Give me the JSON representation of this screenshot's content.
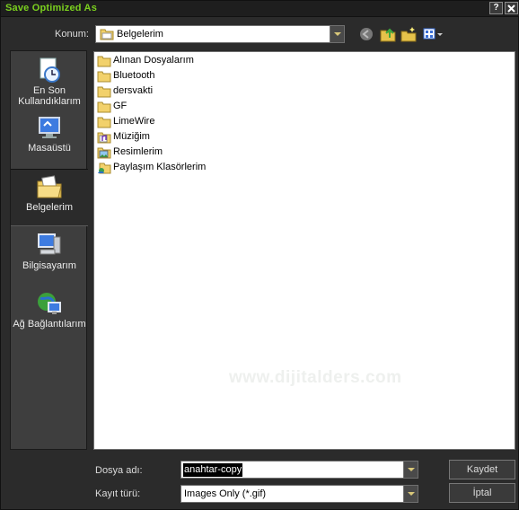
{
  "window": {
    "title": "Save Optimized As",
    "help_glyph": "?",
    "close_glyph": "X"
  },
  "location": {
    "label": "Konum:",
    "value": "Belgelerim"
  },
  "nav": {
    "back_icon": "back-arrow-icon",
    "up_icon": "up-folder-icon",
    "new_folder_icon": "new-folder-icon",
    "views_icon": "views-menu-icon"
  },
  "places": [
    {
      "label": "En Son Kullandıklarım",
      "icon": "recent-documents-icon"
    },
    {
      "label": "Masaüstü",
      "icon": "desktop-icon"
    },
    {
      "label": "Belgelerim",
      "icon": "my-documents-icon",
      "selected": true
    },
    {
      "label": "Bilgisayarım",
      "icon": "my-computer-icon"
    },
    {
      "label": "Ağ Bağlantılarım",
      "icon": "network-places-icon"
    }
  ],
  "files": [
    {
      "name": "Alınan Dosyalarım",
      "icon": "folder-icon"
    },
    {
      "name": "Bluetooth",
      "icon": "folder-icon"
    },
    {
      "name": "dersvakti",
      "icon": "folder-icon"
    },
    {
      "name": "GF",
      "icon": "folder-icon"
    },
    {
      "name": "LimeWire",
      "icon": "folder-icon"
    },
    {
      "name": "Müziğim",
      "icon": "music-folder-icon"
    },
    {
      "name": "Resimlerim",
      "icon": "pictures-folder-icon"
    },
    {
      "name": "Paylaşım Klasörlerim",
      "icon": "shared-folder-icon"
    }
  ],
  "watermark": "www.dijitalders.com",
  "filename": {
    "label": "Dosya adı:",
    "value": "anahtar-copy"
  },
  "filetype": {
    "label": "Kayıt türü:",
    "value": "Images Only (*.gif)"
  },
  "buttons": {
    "save": "Kaydet",
    "cancel": "İptal"
  },
  "colors": {
    "title_text": "#7bd01e",
    "window_bg": "#2b2b2b",
    "selection": "#000000"
  }
}
